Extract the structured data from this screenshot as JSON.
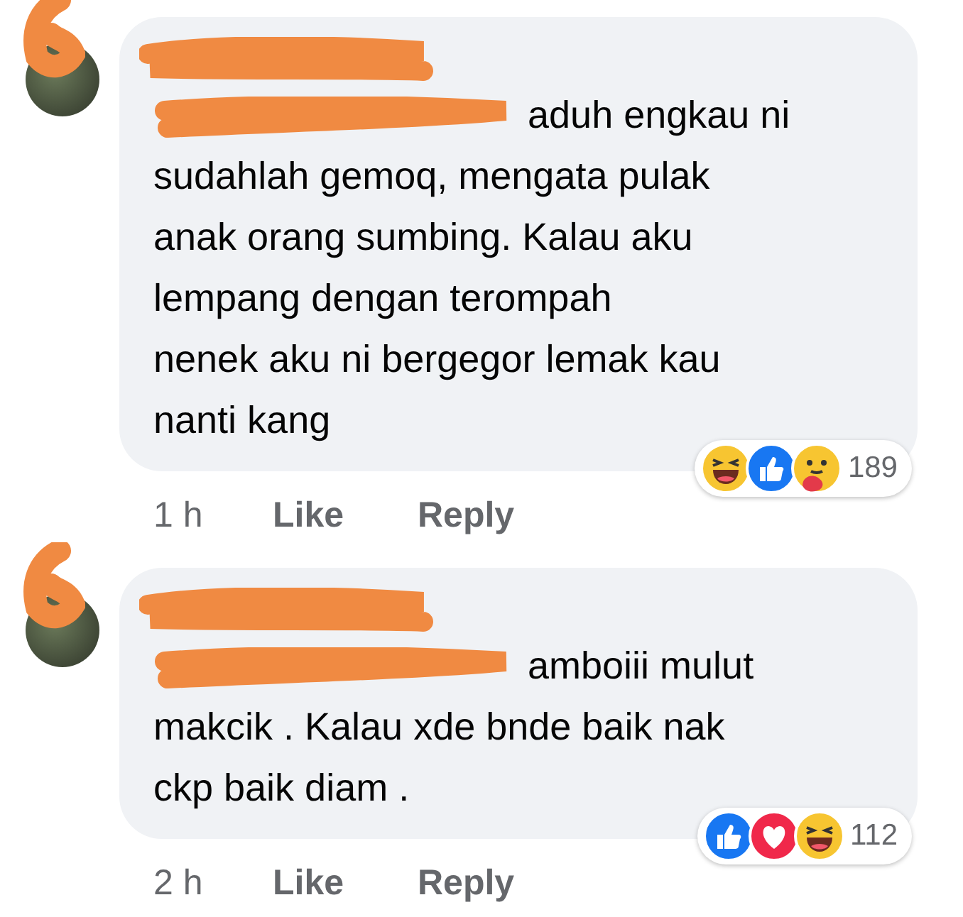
{
  "comments": [
    {
      "author": {
        "redacted": true
      },
      "mention": {
        "redacted": true
      },
      "text": "aduh engkau ni\nsudahlah gemoq, mengata pulak\nanak orang sumbing. Kalau aku\nlempang dengan terompah\nnenek aku ni bergegor lemak kau\nnanti kang",
      "time": "1 h",
      "like": "Like",
      "reply": "Reply",
      "reactions": [
        {
          "kind": "haha"
        },
        {
          "kind": "like"
        },
        {
          "kind": "care"
        }
      ],
      "reaction_count": "189"
    },
    {
      "author": {
        "redacted": true
      },
      "mention": {
        "redacted": true
      },
      "text": "amboiii mulut\nmakcik . Kalau xde bnde baik nak\nckp baik diam .",
      "time": "2 h",
      "like": "Like",
      "reply": "Reply",
      "reactions": [
        {
          "kind": "like"
        },
        {
          "kind": "love"
        },
        {
          "kind": "haha"
        }
      ],
      "reaction_count": "112"
    }
  ]
}
